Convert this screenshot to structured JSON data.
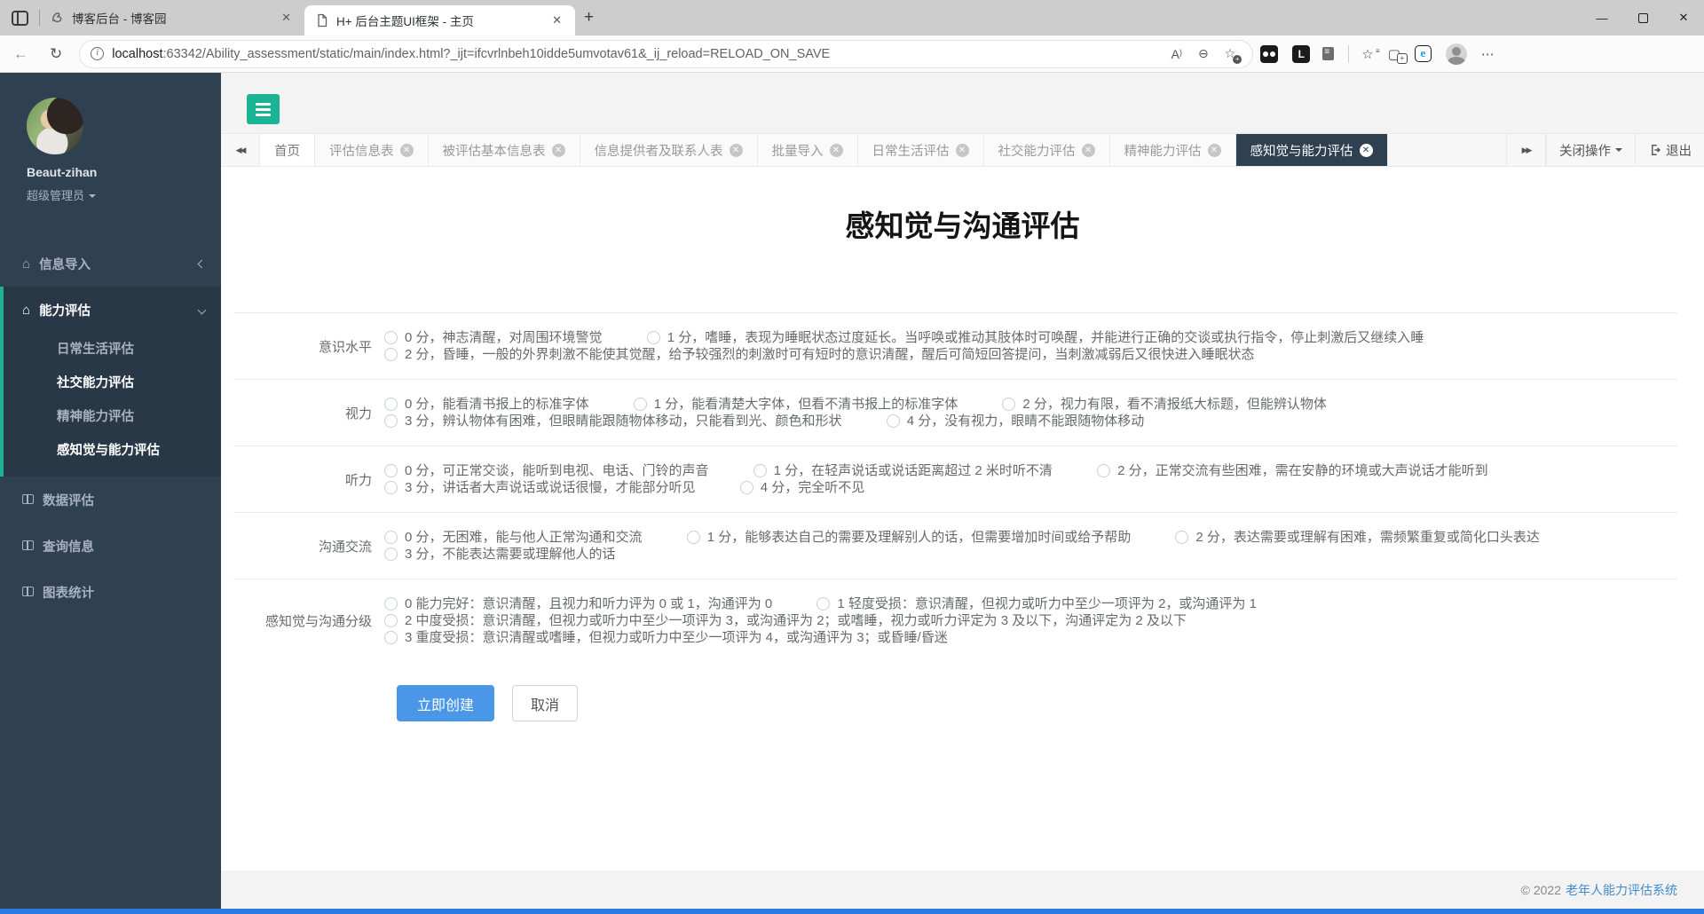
{
  "theme": {
    "green": "#1ab394",
    "sidebar_bg": "#2f4050",
    "sidebar_active_bg": "#293846",
    "button_blue": "#4a97e8",
    "footer_link": "#428bca",
    "bottom_strip": "#2a7ae2"
  },
  "browser": {
    "tabs": [
      {
        "title": "博客后台 - 博客园"
      },
      {
        "title": "H+ 后台主题UI框架 - 主页"
      }
    ],
    "url": {
      "host": "localhost",
      "rest": ":63342/Ability_assessment/static/main/index.html?_ijt=ifcvrlnbeh10idde5umvotav61&_ij_reload=RELOAD_ON_SAVE"
    }
  },
  "sidebar": {
    "user": {
      "name": "Beaut-zihan",
      "role": "超级管理员"
    },
    "menu": [
      {
        "label": "信息导入"
      },
      {
        "label": "能力评估"
      },
      {
        "label": "数据评估"
      },
      {
        "label": "查询信息"
      },
      {
        "label": "图表统计"
      }
    ],
    "submenu": [
      {
        "label": "日常生活评估"
      },
      {
        "label": "社交能力评估"
      },
      {
        "label": "精神能力评估"
      },
      {
        "label": "感知觉与能力评估"
      }
    ]
  },
  "tabbar": {
    "tabs": [
      {
        "label": "首页"
      },
      {
        "label": "评估信息表"
      },
      {
        "label": "被评估基本信息表"
      },
      {
        "label": "信息提供者及联系人表"
      },
      {
        "label": "批量导入"
      },
      {
        "label": "日常生活评估"
      },
      {
        "label": "社交能力评估"
      },
      {
        "label": "精神能力评估"
      },
      {
        "label": "感知觉与能力评估"
      }
    ],
    "close_ops": "关闭操作",
    "exit": "退出"
  },
  "form": {
    "title": "感知觉与沟通评估",
    "rows": [
      {
        "label": "意识水平",
        "options": [
          "0 分，神志清醒，对周围环境警觉",
          "1 分，嗜睡，表现为睡眠状态过度延长。当呼唤或推动其肢体时可唤醒，并能进行正确的交谈或执行指令，停止刺激后又继续入睡",
          "2 分，昏睡，一般的外界刺激不能使其觉醒，给予较强烈的刺激时可有短时的意识清醒，醒后可简短回答提问，当刺激减弱后又很快进入睡眠状态"
        ]
      },
      {
        "label": "视力",
        "options": [
          "0 分，能看清书报上的标准字体",
          "1 分，能看清楚大字体，但看不清书报上的标准字体",
          "2 分，视力有限，看不清报纸大标题，但能辨认物体",
          "3 分，辨认物体有困难，但眼睛能跟随物体移动，只能看到光、颜色和形状",
          "4 分，没有视力，眼睛不能跟随物体移动"
        ]
      },
      {
        "label": "听力",
        "options": [
          "0 分，可正常交谈，能听到电视、电话、门铃的声音",
          "1 分，在轻声说话或说话距离超过 2 米时听不清",
          "2 分，正常交流有些困难，需在安静的环境或大声说话才能听到",
          "3 分，讲话者大声说话或说话很慢，才能部分听见",
          "4 分，完全听不见"
        ]
      },
      {
        "label": "沟通交流",
        "options": [
          "0 分，无困难，能与他人正常沟通和交流",
          "1 分，能够表达自己的需要及理解别人的话，但需要增加时间或给予帮助",
          "2 分，表达需要或理解有困难，需频繁重复或简化口头表达",
          "3 分，不能表达需要或理解他人的话"
        ]
      },
      {
        "label": "感知觉与沟通分级",
        "options": [
          "0 能力完好：意识清醒，且视力和听力评为 0 或 1，沟通评为 0",
          "1 轻度受损：意识清醒，但视力或听力中至少一项评为 2，或沟通评为 1",
          "2 中度受损：意识清醒，但视力或听力中至少一项评为 3，或沟通评为 2；或嗜睡，视力或听力评定为 3 及以下，沟通评定为 2 及以下",
          "3 重度受损：意识清醒或嗜睡，但视力或听力中至少一项评为 4，或沟通评为 3；或昏睡/昏迷"
        ]
      }
    ],
    "submit": "立即创建",
    "cancel": "取消"
  },
  "footer": {
    "copyright": "© 2022",
    "link": "老年人能力评估系统"
  }
}
